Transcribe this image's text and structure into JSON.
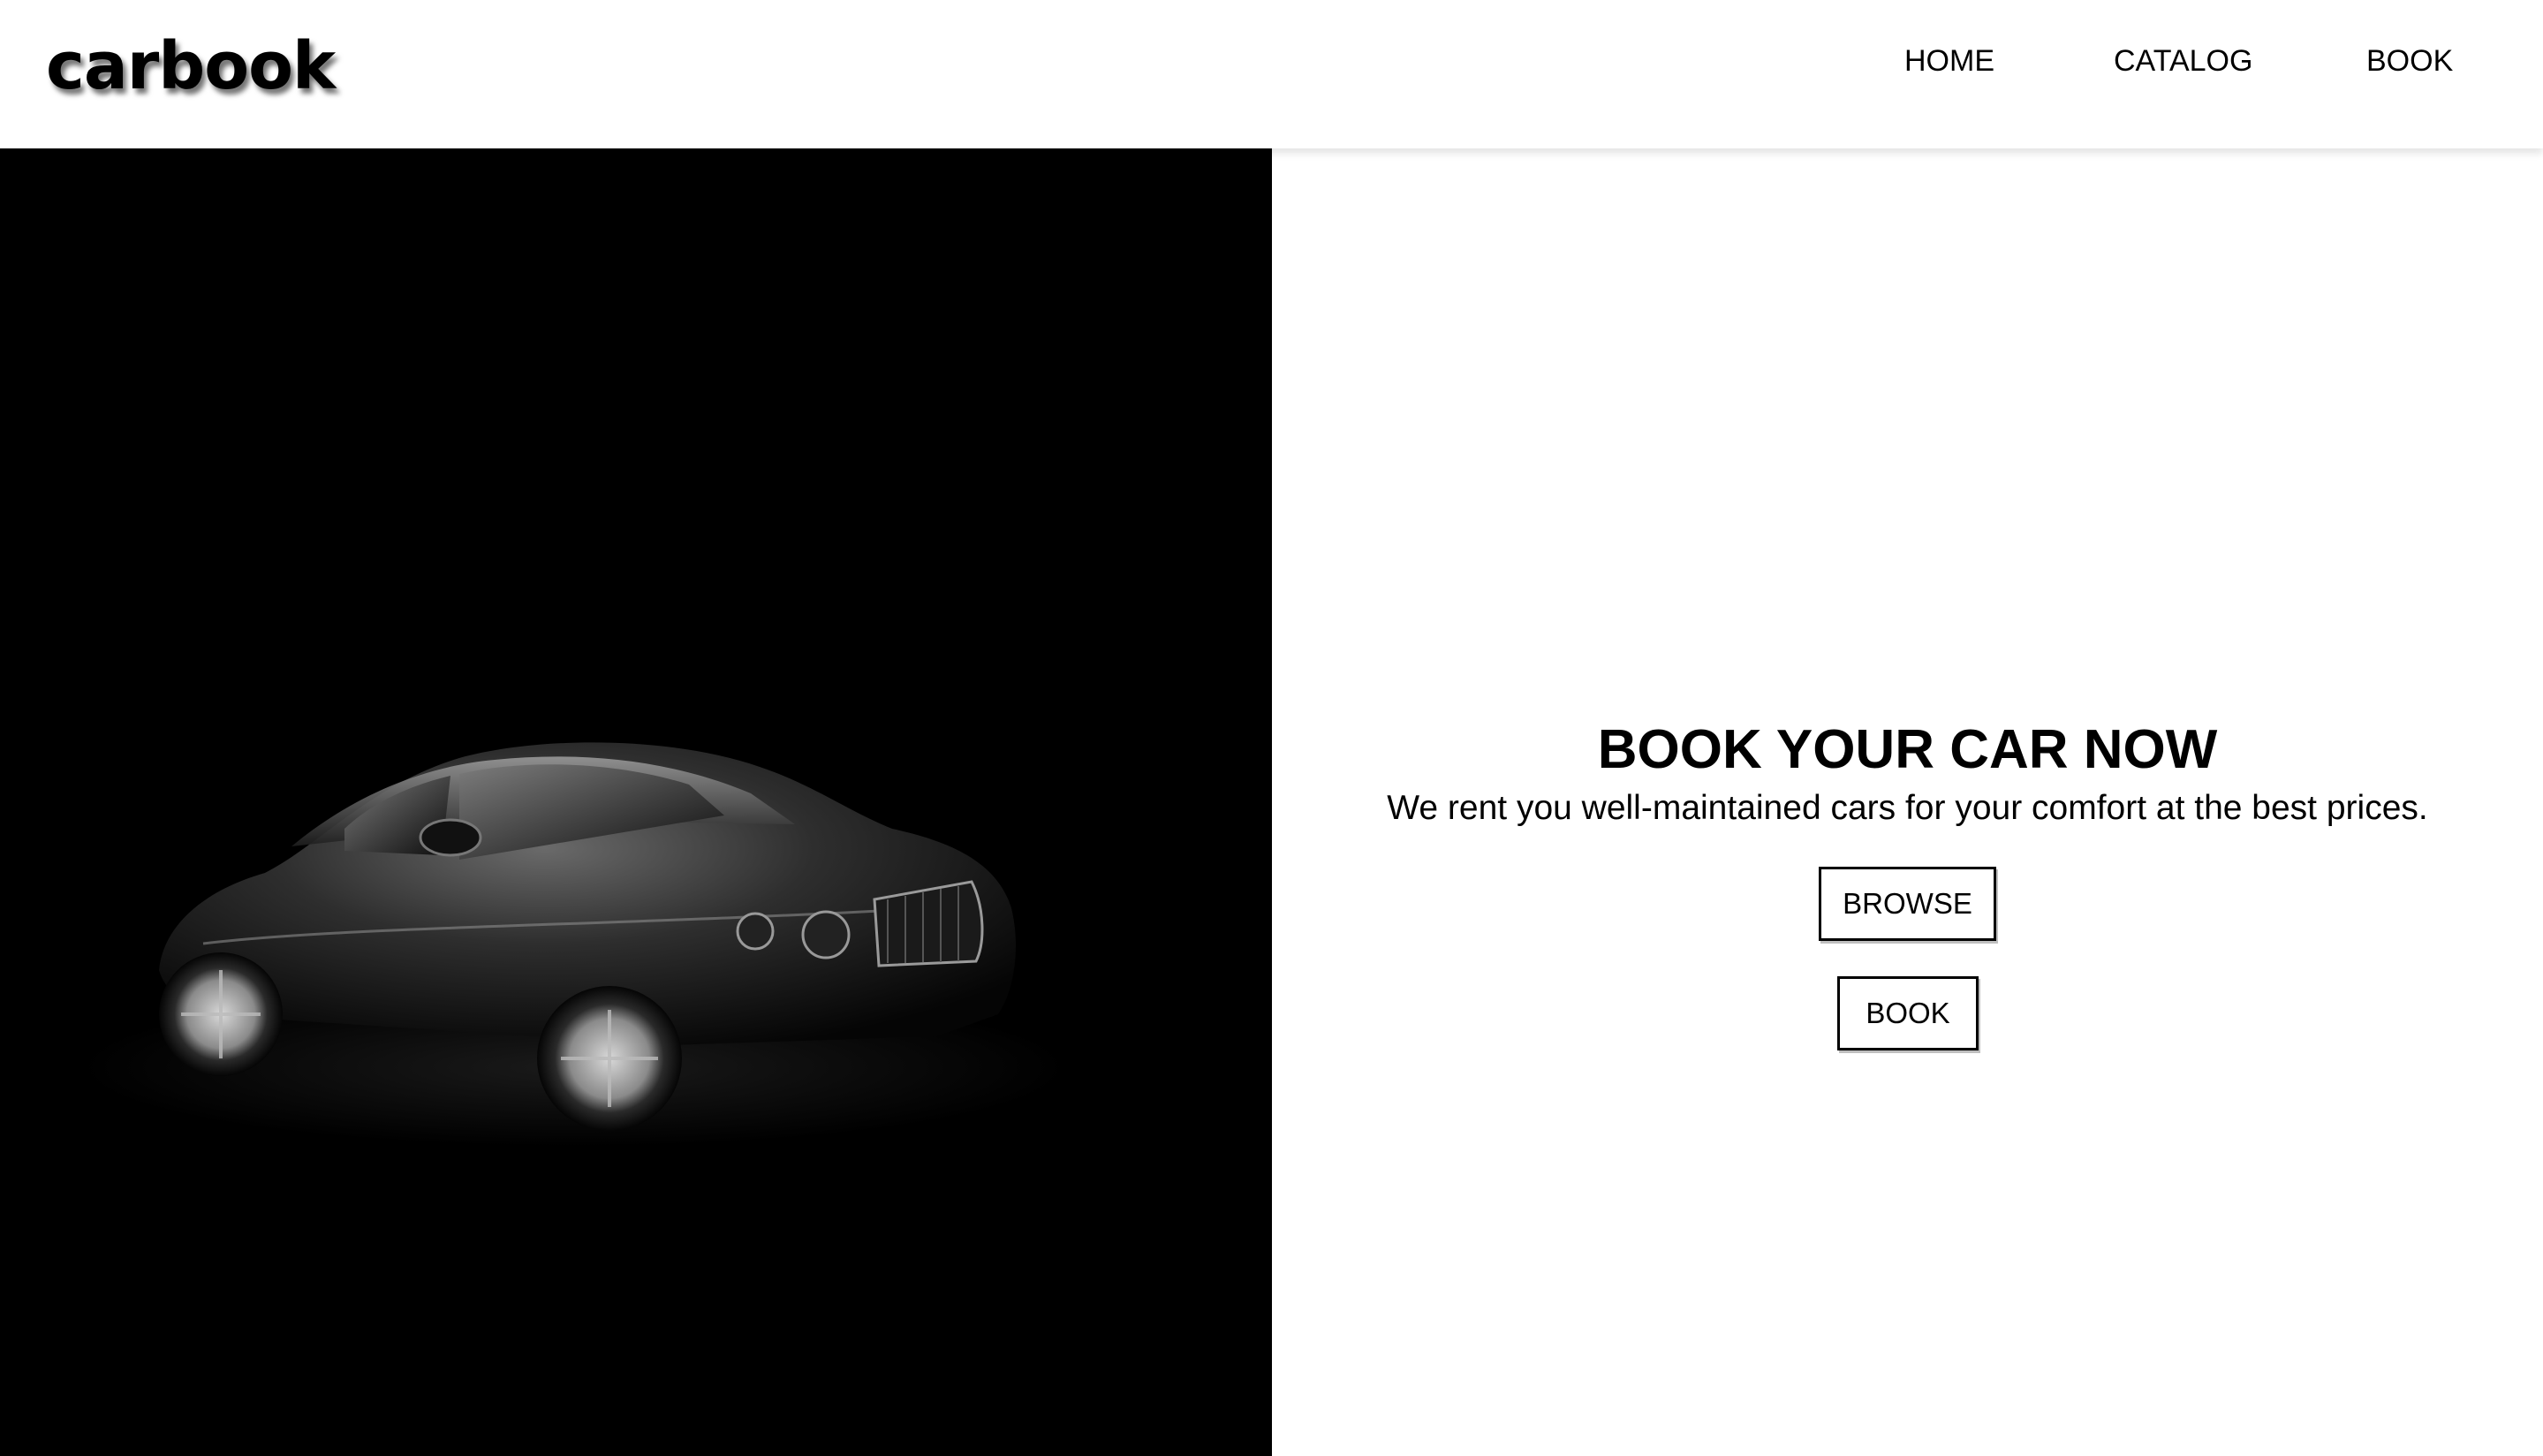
{
  "header": {
    "logo": "carbook",
    "nav": [
      {
        "label": "HOME"
      },
      {
        "label": "CATALOG"
      },
      {
        "label": "BOOK"
      }
    ]
  },
  "hero": {
    "image_alt": "car-image",
    "title": "BOOK YOUR CAR NOW",
    "subtitle": "We rent you well-maintained cars for your comfort at the best prices.",
    "buttons": {
      "browse": "BROWSE",
      "book": "BOOK"
    }
  },
  "colors": {
    "background": "#ffffff",
    "hero_panel": "#000000",
    "text": "#000000"
  }
}
